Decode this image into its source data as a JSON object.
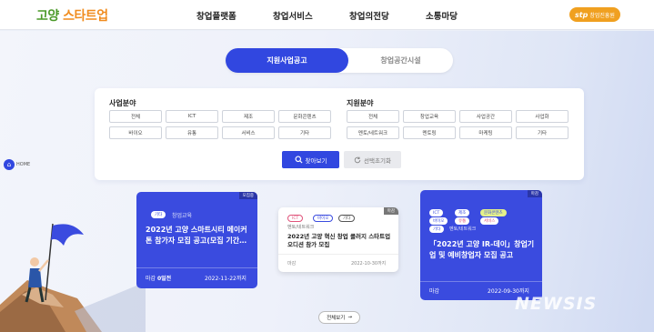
{
  "header": {
    "logo": {
      "part1": "고양",
      "part2": "스타트업"
    },
    "nav": [
      "창업플랫폼",
      "창업서비스",
      "창업의전당",
      "소통마당"
    ],
    "badge": {
      "mark": "stp",
      "text": "창업진흥원"
    }
  },
  "tabs": [
    "지원사업공고",
    "창업공간시설"
  ],
  "filters": {
    "business": {
      "title": "사업분야",
      "chips": [
        "전체",
        "ICT",
        "제조",
        "문화콘텐츠",
        "바이오",
        "유통",
        "서비스",
        "기타"
      ]
    },
    "support": {
      "title": "지원분야",
      "chips": [
        "전체",
        "창업교육",
        "사업공간",
        "사업화",
        "멘토/네트워크",
        "멘토링",
        "마케팅",
        "기타"
      ]
    },
    "search_label": "찾아보기",
    "reset_label": "선택초기화"
  },
  "side": {
    "home_label": "HOME"
  },
  "cards": [
    {
      "corner": "모집중",
      "tags": [
        "기타"
      ],
      "category": "창업교육",
      "title": "2022년 고양 스마트시티 메이커톤 참가자 모집 공고(모집 기간…",
      "dday_label": "마감",
      "dday_value": "0일전",
      "deadline": "2022-11-22까지"
    },
    {
      "corner": "마감",
      "tags": [
        "ICT",
        "바이오",
        "기타"
      ],
      "category": "멘토/네트워크",
      "title": "2022년 고양 혁신 창업 클러지 스타트업 오디션 참가 모집",
      "dday_label": "마감",
      "dday_value": "",
      "deadline": "2022-10-30까지"
    },
    {
      "corner": "마감",
      "tags": [
        "ICT",
        "제조",
        "문화콘텐츠",
        "바이오",
        "유통",
        "서비스",
        "기타"
      ],
      "category": "멘토/네트워크",
      "title": "「2022년 고양 IR-데이」창업기업 및 예비창업자 모집 공고",
      "dday_label": "마감",
      "dday_value": "",
      "deadline": "2022-09-30까지"
    }
  ],
  "view_all": "전체보기",
  "watermark": "NEWSIS"
}
